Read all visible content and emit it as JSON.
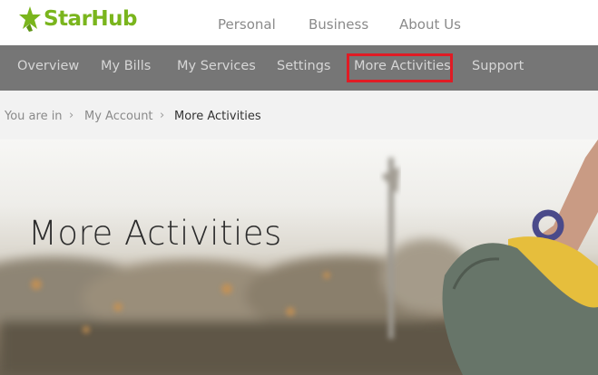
{
  "brand": {
    "name": "StarHub",
    "color": "#7ab51d"
  },
  "top_nav": [
    "Personal",
    "Business",
    "About Us"
  ],
  "main_nav": {
    "items": [
      "Overview",
      "My Bills",
      "My Services",
      "Settings",
      "More Activities",
      "Support"
    ],
    "active": "More Activities",
    "highlight_color": "#e01b24"
  },
  "breadcrumb": {
    "prefix": "You are in",
    "items": [
      "My Account",
      "More Activities"
    ]
  },
  "hero": {
    "title": "More Activities"
  }
}
